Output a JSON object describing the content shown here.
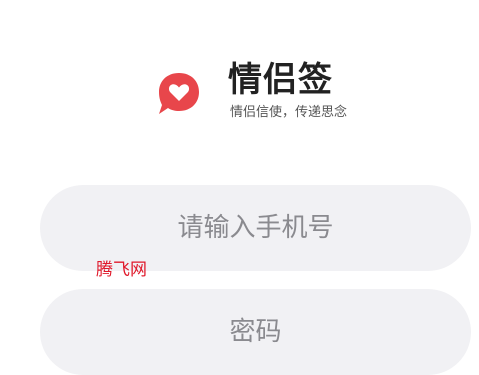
{
  "brand": {
    "app_name": "情侣签",
    "slogan": "情侣信使，传递思念",
    "logo_icon": "heart-chat-bubble-icon",
    "logo_color": "#e8464b"
  },
  "login_form": {
    "phone_placeholder": "请输入手机号",
    "password_placeholder": "密码"
  },
  "watermark": {
    "text": "腾飞网",
    "color": "#e0182a"
  }
}
